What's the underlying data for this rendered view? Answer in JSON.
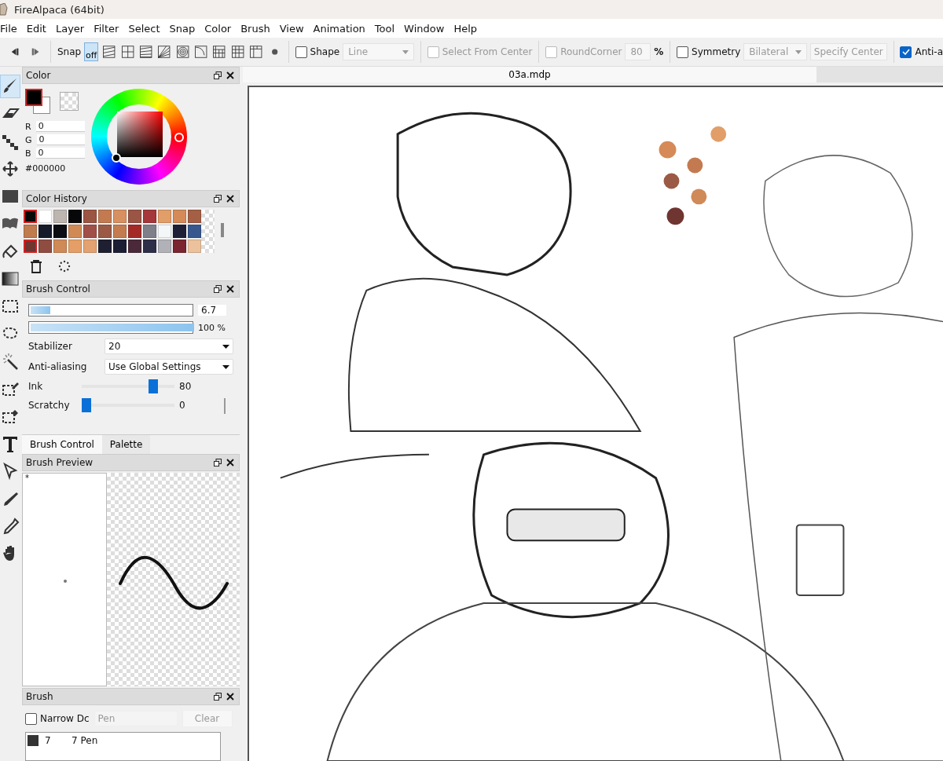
{
  "window": {
    "title": "FireAlpaca (64bit)"
  },
  "menu": [
    "File",
    "Edit",
    "Layer",
    "Filter",
    "Select",
    "Snap",
    "Color",
    "Brush",
    "View",
    "Animation",
    "Tool",
    "Window",
    "Help"
  ],
  "toolbar": {
    "snap_label": "Snap",
    "snap_modes": [
      {
        "kind": "off",
        "label": "off",
        "selected": true
      },
      {
        "kind": "parallel",
        "selected": false
      },
      {
        "kind": "cross",
        "selected": false
      },
      {
        "kind": "vanish",
        "selected": false
      },
      {
        "kind": "radial",
        "selected": false
      },
      {
        "kind": "concentric",
        "selected": false
      },
      {
        "kind": "curve",
        "selected": false
      },
      {
        "kind": "perspective",
        "selected": false
      },
      {
        "kind": "grid",
        "selected": false
      },
      {
        "kind": "ruler",
        "selected": false
      },
      {
        "kind": "dot",
        "selected": false
      }
    ],
    "shape": {
      "label": "Shape",
      "checked": false
    },
    "shape_type": {
      "value": "Line",
      "disabled": true
    },
    "select_from_center": {
      "label": "Select From Center",
      "checked": false,
      "disabled": true
    },
    "round_corner": {
      "label": "RoundCorner",
      "checked": false,
      "disabled": true
    },
    "round_value": {
      "value": "80",
      "disabled": true
    },
    "percent": "%",
    "symmetry": {
      "label": "Symmetry",
      "checked": false
    },
    "symmetry_type": {
      "value": "Bilateral",
      "disabled": true
    },
    "specify_center": {
      "label": "Specify Center",
      "disabled": true
    },
    "anti_aliasing": {
      "label": "Anti-a",
      "checked": true
    }
  },
  "tools": [
    {
      "kind": "brush",
      "selected": true
    },
    {
      "kind": "eraser",
      "selected": false
    },
    {
      "kind": "dot",
      "selected": false
    },
    {
      "kind": "move",
      "selected": false
    },
    {
      "kind": "fill",
      "selected": false
    },
    {
      "kind": "blur",
      "selected": false
    },
    {
      "kind": "bucket",
      "selected": false
    },
    {
      "kind": "gradient",
      "selected": false
    },
    {
      "kind": "select",
      "selected": false
    },
    {
      "kind": "lasso",
      "selected": false
    },
    {
      "kind": "wand",
      "selected": false
    },
    {
      "kind": "selpen",
      "selected": false
    },
    {
      "kind": "seleraser",
      "selected": false
    },
    {
      "kind": "text",
      "selected": false
    },
    {
      "kind": "operation",
      "selected": false
    },
    {
      "kind": "pen",
      "selected": false
    },
    {
      "kind": "dropper",
      "selected": false
    },
    {
      "kind": "hand",
      "selected": false
    }
  ],
  "color_panel": {
    "title": "Color",
    "r": {
      "label": "R",
      "value": "0"
    },
    "g": {
      "label": "G",
      "value": "0"
    },
    "b": {
      "label": "B",
      "value": "0"
    },
    "hex": "#000000"
  },
  "color_history": {
    "title": "Color History",
    "swatches": [
      {
        "color": "#080808",
        "selected": true
      },
      {
        "color": "#ffffff",
        "selected": false
      },
      {
        "color": "#bdb5b0",
        "selected": false
      },
      {
        "color": "#07070a",
        "selected": false
      },
      {
        "color": "#9a5543",
        "selected": false
      },
      {
        "color": "#c47a50",
        "selected": false
      },
      {
        "color": "#d99060",
        "selected": false
      },
      {
        "color": "#9b5545",
        "selected": false
      },
      {
        "color": "#a5363a",
        "selected": false
      },
      {
        "color": "#e29e68",
        "selected": false
      },
      {
        "color": "#d58a57",
        "selected": false
      },
      {
        "color": "#a55f45",
        "selected": false
      },
      {
        "color": "#c07b4e",
        "selected": false
      },
      {
        "color": "#161b2c",
        "selected": false
      },
      {
        "color": "#0b0d12",
        "selected": false
      },
      {
        "color": "#d08a55",
        "selected": false
      },
      {
        "color": "#a05049",
        "selected": false
      },
      {
        "color": "#9b5a45",
        "selected": false
      },
      {
        "color": "#c47b50",
        "selected": false
      },
      {
        "color": "#a42a28",
        "selected": false
      },
      {
        "color": "#7f7f8a",
        "selected": false
      },
      {
        "color": "#f4f7f8",
        "selected": false
      },
      {
        "color": "#1e2038",
        "selected": false
      },
      {
        "color": "#37578e",
        "selected": false
      },
      {
        "color": "#6f3530",
        "selected": true
      },
      {
        "color": "#8f4d42",
        "selected": false
      },
      {
        "color": "#cf8a58",
        "selected": false
      },
      {
        "color": "#e59f66",
        "selected": false
      },
      {
        "color": "#e4a271",
        "selected": false
      },
      {
        "color": "#1e1f30",
        "selected": false
      },
      {
        "color": "#1c1e33",
        "selected": false
      },
      {
        "color": "#4a2a3a",
        "selected": false
      },
      {
        "color": "#2e2e48",
        "selected": false
      },
      {
        "color": "#b1b1b8",
        "selected": false
      },
      {
        "color": "#7a2530",
        "selected": false
      },
      {
        "color": "#ecc29d",
        "selected": false
      }
    ]
  },
  "brush_control": {
    "title": "Brush Control",
    "size": {
      "level": 0.12,
      "reading": "6.7"
    },
    "opacity": {
      "level": 1.0,
      "reading": "100 %"
    },
    "stabilizer": {
      "label": "Stabilizer",
      "value": "20"
    },
    "antialiasing": {
      "label": "Anti-aliasing",
      "value": "Use Global Settings"
    },
    "ink": {
      "label": "Ink",
      "level": 0.8,
      "reading": "80"
    },
    "scratchy": {
      "label": "Scratchy",
      "level": 0.0,
      "reading": "0"
    }
  },
  "panel_tabs": [
    {
      "label": "Brush Control",
      "selected": true
    },
    {
      "label": "Palette",
      "selected": false
    }
  ],
  "brush_preview": {
    "title": "Brush Preview",
    "mark": "*"
  },
  "brush_panel": {
    "title": "Brush",
    "narrow": {
      "label": "Narrow Dc",
      "checked": false
    },
    "search": {
      "placeholder": "Pen"
    },
    "clear": {
      "label": "Clear",
      "disabled": true
    },
    "items": [
      {
        "size": "7",
        "name": "7 Pen",
        "selected": false
      }
    ]
  },
  "document_tab": {
    "label": "03a.mdp"
  }
}
